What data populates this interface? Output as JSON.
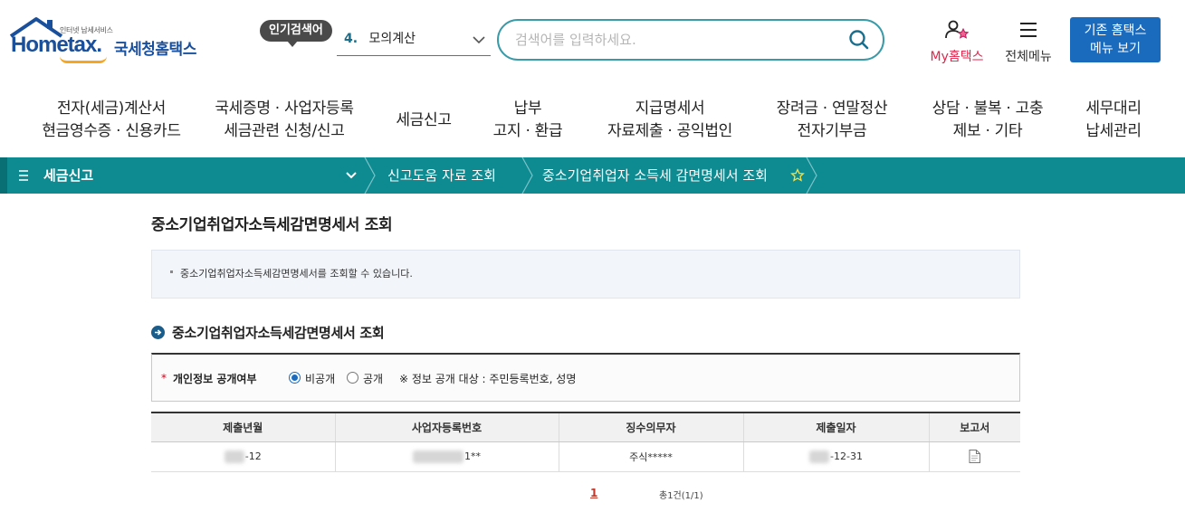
{
  "header": {
    "logo": {
      "small": "인터넷 납세서비스",
      "brand": "Hometax.",
      "kr": "국세청홈택스"
    },
    "popular": {
      "badge": "인기검색어",
      "number": "4.",
      "term": "모의계산"
    },
    "search": {
      "placeholder": "검색어를 입력하세요."
    },
    "my_hometax": "My홈택스",
    "all_menu": "전체메뉴",
    "old_menu": {
      "line1": "기존 홈택스",
      "line2": "메뉴 보기"
    }
  },
  "mainnav": [
    {
      "line1": "전자(세금)계산서",
      "line2": "현금영수증 · 신용카드"
    },
    {
      "line1": "국세증명 · 사업자등록",
      "line2": "세금관련 신청/신고"
    },
    {
      "line1": "세금신고",
      "line2": ""
    },
    {
      "line1": "납부",
      "line2": "고지 · 환급"
    },
    {
      "line1": "지급명세서",
      "line2": "자료제출 · 공익법인"
    },
    {
      "line1": "장려금 · 연말정산",
      "line2": "전자기부금"
    },
    {
      "line1": "상담 · 불복 · 고충",
      "line2": "제보 · 기타"
    },
    {
      "line1": "세무대리",
      "line2": "납세관리"
    }
  ],
  "breadcrumb": {
    "root": "세금신고",
    "level2": "신고도움 자료 조회",
    "level3": "중소기업취업자 소득세 감면명세서 조회"
  },
  "content": {
    "page_title": "중소기업취업자소득세감면명세서 조회",
    "notice": "중소기업취업자소득세감면명세서를 조회할 수 있습니다.",
    "section_title": "중소기업취업자소득세감면명세서 조회",
    "filter": {
      "required_mark": "*",
      "label": "개인정보 공개여부",
      "option_private": "비공개",
      "option_public": "공개",
      "note": "※ 정보 공개 대상 : 주민등록번호, 성명"
    },
    "table": {
      "headers": [
        "제출년월",
        "사업자등록번호",
        "징수의무자",
        "제출일자",
        "보고서"
      ],
      "rows": [
        {
          "month": "-12",
          "bizno": "1**",
          "payer": "주식*****",
          "date": "-12-31"
        }
      ]
    },
    "pager": {
      "current": "1",
      "total": "총1건(1/1)"
    }
  },
  "colors": {
    "teal": "#0e8a91",
    "blue": "#1a6bbd",
    "red": "#e0264c"
  }
}
